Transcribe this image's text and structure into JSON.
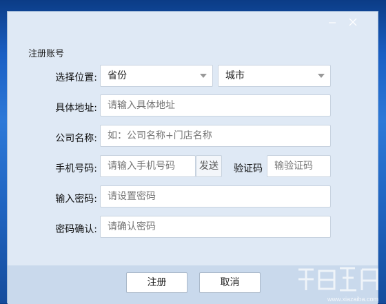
{
  "dialog": {
    "section_title": "注册账号"
  },
  "form": {
    "location_label": "选择位置:",
    "province_value": "省份",
    "city_value": "城市",
    "address_label": "具体地址:",
    "address_placeholder": "请输入具体地址",
    "company_label": "公司名称:",
    "company_placeholder": "如：公司名称+门店名称",
    "phone_label": "手机号码:",
    "phone_placeholder": "请输入手机号码",
    "send_label": "发送",
    "code_label": "验证码",
    "code_placeholder": "输验证码",
    "password_label": "输入密码:",
    "password_placeholder": "请设置密码",
    "confirm_label": "密码确认:",
    "confirm_placeholder": "请确认密码"
  },
  "footer": {
    "register_label": "注册",
    "cancel_label": "取消"
  },
  "watermark": {
    "url_text": "www.xiazaiba.com"
  }
}
